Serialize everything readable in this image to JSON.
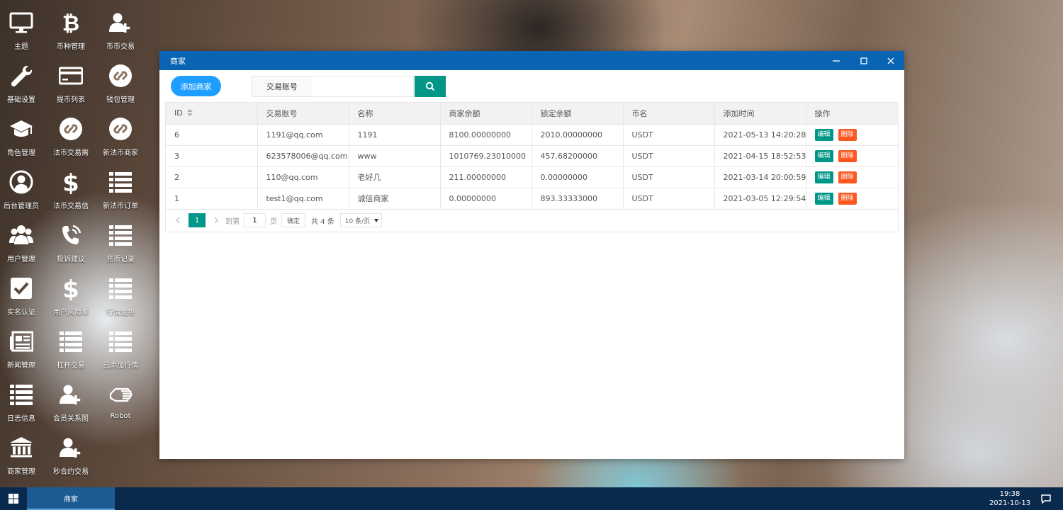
{
  "desktop": {
    "icons": [
      {
        "label": "主题",
        "icon": "monitor-icon"
      },
      {
        "label": "币种管理",
        "icon": "bitcoin-icon"
      },
      {
        "label": "币币交易",
        "icon": "user-plus-icon"
      },
      {
        "label": "基础设置",
        "icon": "wrench-icon"
      },
      {
        "label": "提币列表",
        "icon": "credit-card-icon"
      },
      {
        "label": "钱包管理",
        "icon": "chain-link-icon"
      },
      {
        "label": "角色管理",
        "icon": "graduation-cap-icon"
      },
      {
        "label": "法币交易需",
        "icon": "chain-link-icon"
      },
      {
        "label": "新法币商家",
        "icon": "chain-link-icon"
      },
      {
        "label": "后台管理员",
        "icon": "user-circle-icon"
      },
      {
        "label": "法币交易信",
        "icon": "dollar-icon"
      },
      {
        "label": "新法币订单",
        "icon": "list-icon"
      },
      {
        "label": "用户管理",
        "icon": "users-icon"
      },
      {
        "label": "投诉建议",
        "icon": "phone-volume-icon"
      },
      {
        "label": "充币记录",
        "icon": "list-icon"
      },
      {
        "label": "实名认证",
        "icon": "check-square-icon"
      },
      {
        "label": "用户风险率",
        "icon": "dollar-icon"
      },
      {
        "label": "行情走势",
        "icon": "list-icon"
      },
      {
        "label": "新闻管理",
        "icon": "newspaper-icon"
      },
      {
        "label": "杠杆交易",
        "icon": "list-icon"
      },
      {
        "label": "已添加行情",
        "icon": "list-icon"
      },
      {
        "label": "日志信息",
        "icon": "list-icon"
      },
      {
        "label": "会员关系图",
        "icon": "user-plus-icon"
      },
      {
        "label": "Robot",
        "icon": "hand-icon"
      },
      {
        "label": "商家管理",
        "icon": "bank-icon"
      },
      {
        "label": "秒合约交易",
        "icon": "user-plus-icon"
      }
    ]
  },
  "window": {
    "title": "商家",
    "controls": [
      "minimize-icon",
      "maximize-icon",
      "close-icon"
    ]
  },
  "toolbar": {
    "add_label": "添加商家",
    "search_label": "交易账号",
    "search_value": "",
    "search_placeholder": ""
  },
  "table": {
    "columns": [
      "ID",
      "交易账号",
      "名称",
      "商家余额",
      "锁定余额",
      "币名",
      "添加时间",
      "操作"
    ],
    "rows": [
      {
        "id": "6",
        "account": "1191@qq.com",
        "name": "1191",
        "balance": "8100.00000000",
        "locked": "2010.00000000",
        "coin": "USDT",
        "time": "2021-05-13 14:20:28"
      },
      {
        "id": "3",
        "account": "623578006@qq.com",
        "name": "www",
        "balance": "1010769.23010000",
        "locked": "457.68200000",
        "coin": "USDT",
        "time": "2021-04-15 18:52:53"
      },
      {
        "id": "2",
        "account": "110@qq.com",
        "name": "老好几",
        "balance": "211.00000000",
        "locked": "0.00000000",
        "coin": "USDT",
        "time": "2021-03-14 20:00:59"
      },
      {
        "id": "1",
        "account": "test1@qq.com",
        "name": "诚信商家",
        "balance": "0.00000000",
        "locked": "893.33333000",
        "coin": "USDT",
        "time": "2021-03-05 12:29:54"
      }
    ],
    "edit_label": "编辑",
    "delete_label": "删除"
  },
  "pager": {
    "current": "1",
    "goto_label": "到第",
    "goto_value": "1",
    "page_unit": "页",
    "confirm_label": "确定",
    "total": "共 4 条",
    "page_size": "10 条/页"
  },
  "taskbar": {
    "task_label": "商家",
    "time": "19:38",
    "date": "2021-10-13"
  },
  "colors": {
    "titlebar": "#0a64b4",
    "add_button": "#1e9fff",
    "teal": "#009688",
    "danger": "#ff5722",
    "taskbar": "#0a2a4d"
  }
}
